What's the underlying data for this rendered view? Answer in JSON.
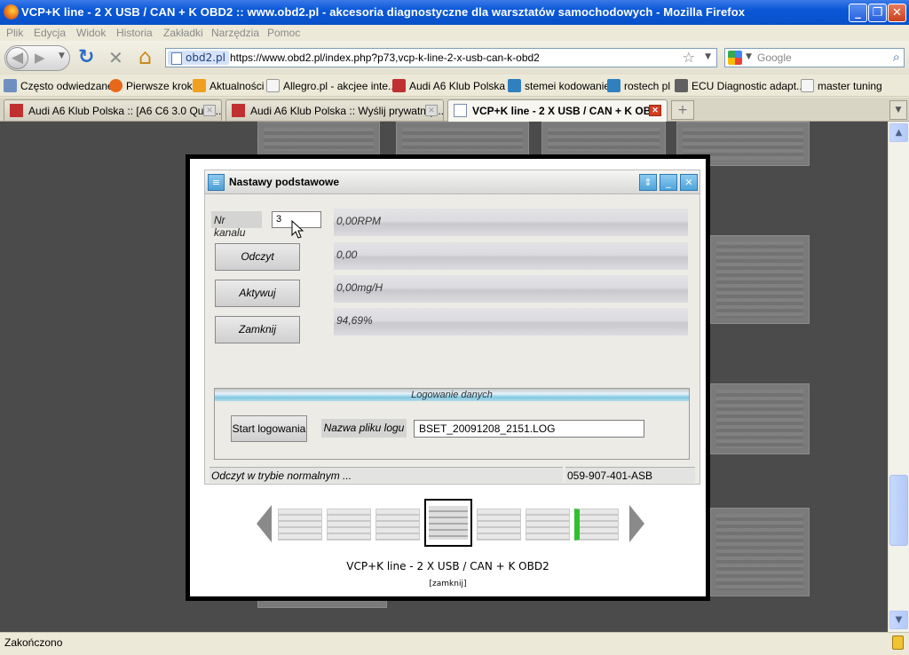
{
  "window": {
    "title": "VCP+K line - 2 X USB / CAN + K OBD2 :: www.obd2.pl - akcesoria diagnostyczne dla warsztatów samochodowych - Mozilla Firefox",
    "min_label": "_",
    "max_label": "❐",
    "close_label": "✕"
  },
  "menu": [
    "Plik",
    "Edycja",
    "Widok",
    "Historia",
    "Zakładki",
    "Narzędzia",
    "Pomoc"
  ],
  "nav": {
    "back_icon": "◀",
    "forward_icon": "▶",
    "reload_icon": "↻",
    "stop_icon": "✕",
    "home_icon": "⌂",
    "site_label": "obd2.pl",
    "url": "https://www.obd2.pl/index.php?p73,vcp-k-line-2-x-usb-can-k-obd2",
    "search_placeholder": "Google"
  },
  "bookmarks": [
    {
      "label": "Często odwiedzane",
      "icon": "#6f8fc0"
    },
    {
      "label": "Pierwsze kroki",
      "icon": "#e8681a"
    },
    {
      "label": "Aktualności",
      "icon": "#f0a020"
    },
    {
      "label": "Allegro.pl - akcjee inte...",
      "icon": "#f5f5f5"
    },
    {
      "label": "Audi A6 Klub Polska ::",
      "icon": "#c03030"
    },
    {
      "label": "stemei kodowanie",
      "icon": "#3080c0"
    },
    {
      "label": "rostech pl",
      "icon": "#3080c0"
    },
    {
      "label": "ECU Diagnostic adapt...",
      "icon": "#606060"
    },
    {
      "label": "master tuning",
      "icon": "#f5f5f5"
    }
  ],
  "tabs": [
    {
      "label": "Audi A6 Klub Polska :: [A6 C6 3.0 Quat...",
      "close": "✕"
    },
    {
      "label": "Audi A6 Klub Polska :: Wyślij prywatną ...",
      "close": "✕"
    },
    {
      "label": "VCP+K line - 2 X USB / CAN + K OB...",
      "close": "✕"
    }
  ],
  "app": {
    "title": "Nastawy podstawowe",
    "channel_label": "Nr kanalu",
    "channel_value": "3",
    "buttons": {
      "read": "Odczyt",
      "activate": "Aktywuj",
      "close": "Zamknij"
    },
    "readings": [
      "0,00RPM",
      "0,00",
      "0,00mg/H",
      "94,69%"
    ],
    "log_section_title": "Logowanie danych",
    "start_log": "Start logowania",
    "log_file_label": "Nazwa pliku logu",
    "log_file_value": "BSET_20091208_2151.LOG",
    "status_text": "Odczyt w trybie normalnym ...",
    "part_number": "059-907-401-ASB"
  },
  "lightbox": {
    "caption": "VCP+K line - 2 X USB / CAN + K OBD2",
    "close_link": "[zamknij]"
  },
  "statusbar": {
    "text": "Zakończono"
  }
}
